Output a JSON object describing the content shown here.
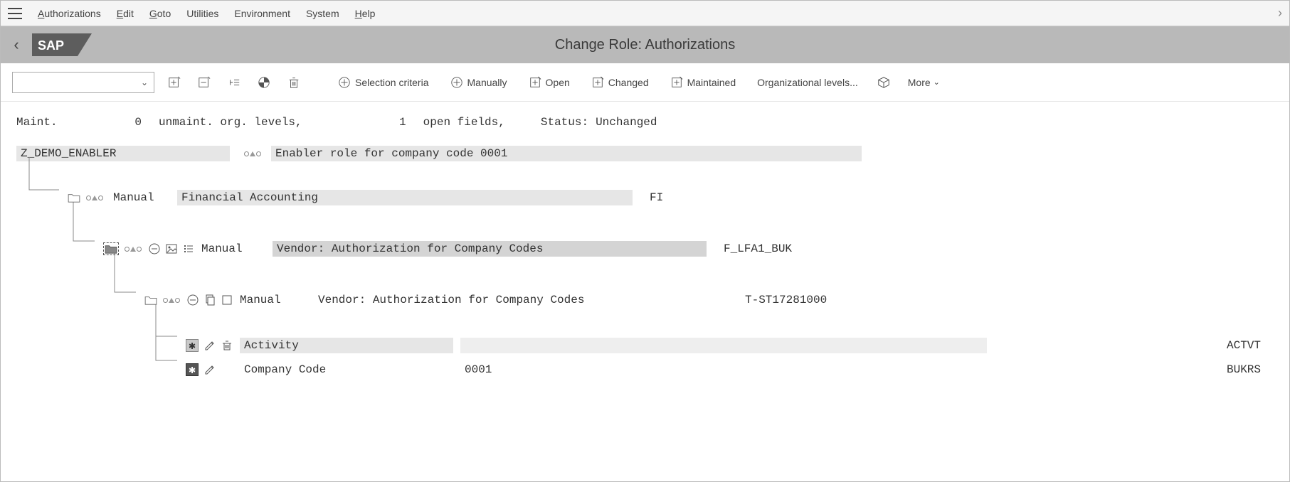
{
  "menubar": {
    "items": [
      {
        "label": "Authorizations",
        "ul": "A",
        "rest": "uthorizations"
      },
      {
        "label": "Edit",
        "ul": "E",
        "rest": "dit"
      },
      {
        "label": "Goto",
        "ul": "G",
        "rest": "oto"
      },
      {
        "label": "Utilities",
        "ul": "",
        "rest": "Utilities"
      },
      {
        "label": "Environment",
        "ul": "",
        "rest": "Environment"
      },
      {
        "label": "System",
        "ul": "",
        "rest": "System"
      },
      {
        "label": "Help",
        "ul": "H",
        "rest": "elp"
      }
    ]
  },
  "title": "Change Role: Authorizations",
  "toolbar": {
    "selection_criteria": "Selection criteria",
    "manually": "Manually",
    "open": "Open",
    "changed": "Changed",
    "maintained": "Maintained",
    "org_levels": "Organizational levels...",
    "more": "More"
  },
  "status": {
    "maint_label": "Maint.",
    "maint_count": "0",
    "unmaint_label": "unmaint. org. levels,",
    "open_count": "1",
    "open_label": "open fields,",
    "status_label": "Status:",
    "status_value": "Unchanged"
  },
  "tree": {
    "root": {
      "name": "Z_DEMO_ENABLER",
      "desc": "Enabler role for company code 0001"
    },
    "l1": {
      "status": "Manual",
      "desc": "Financial Accounting",
      "code": "FI"
    },
    "l2": {
      "status": "Manual",
      "desc": "Vendor: Authorization for Company Codes",
      "code": "F_LFA1_BUK"
    },
    "l3": {
      "status": "Manual",
      "desc": "Vendor: Authorization for Company Codes",
      "code": "T-ST17281000"
    },
    "fields": [
      {
        "label": "Activity",
        "value": "",
        "code": "ACTVT",
        "required": true,
        "deletable": true
      },
      {
        "label": "Company Code",
        "value": "0001",
        "code": "BUKRS",
        "required": true,
        "deletable": false
      }
    ]
  }
}
